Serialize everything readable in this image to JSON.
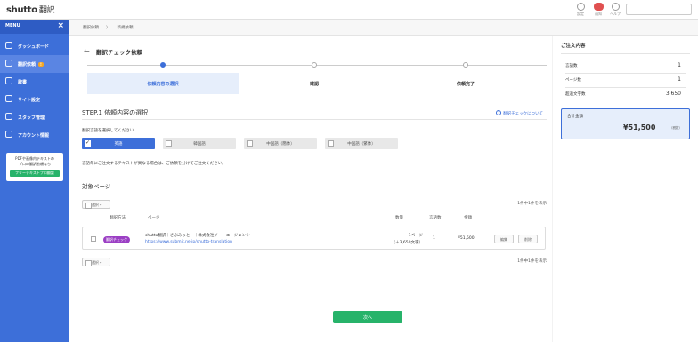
{
  "app": {
    "logo": "shutto",
    "logo_sub": "翻訳"
  },
  "topbar": {
    "icons": [
      {
        "name": "settings-icon",
        "label": "設定"
      },
      {
        "name": "notification-icon",
        "label": "通知"
      },
      {
        "name": "help-icon",
        "label": "ヘルプ"
      }
    ]
  },
  "sidebar": {
    "menu_label": "MENU",
    "close_icon": "×",
    "items": [
      {
        "label": "ダッシュボード",
        "icon": "dashboard-icon"
      },
      {
        "label": "翻訳依頼",
        "icon": "translation-request-icon",
        "badge": "!"
      },
      {
        "label": "辞書",
        "icon": "dictionary-icon"
      },
      {
        "label": "サイト設定",
        "icon": "gear-icon"
      },
      {
        "label": "スタッフ管理",
        "icon": "staff-icon"
      },
      {
        "label": "アカウント情報",
        "icon": "account-icon"
      }
    ],
    "promo": {
      "line1": "PDFや画像内テキストの",
      "line2": "プロの翻訳依頼なら",
      "button": "フリーテキストプロ翻訳"
    }
  },
  "breadcrumb": {
    "items": [
      "翻訳依頼",
      "新規依頼"
    ],
    "separator": "〉"
  },
  "main": {
    "back_icon": "←",
    "title": "翻訳チェック依頼",
    "steps": [
      "依頼内容の選択",
      "確認",
      "依頼完了"
    ],
    "step1_title": "STEP.1 依頼内容の選択",
    "help_link": "翻訳チェックについて",
    "lang_prompt": "翻訳言語を選択してください",
    "languages": [
      {
        "label": "英語",
        "checked": true
      },
      {
        "label": "韓国語",
        "checked": false
      },
      {
        "label": "中国語（簡体）",
        "checked": false
      },
      {
        "label": "中国語（繁体）",
        "checked": false
      }
    ],
    "lang_note": "言語毎にご注文するテキストが異なる場合は、ご依頼を分けてご注文ください。",
    "section_title": "対象ページ",
    "select_label": "選択",
    "count_top": "1件中1件を表示",
    "count_bottom": "1件中1件を表示",
    "columns": {
      "method": "翻訳方法",
      "page": "ページ",
      "quantity": "数量",
      "langs": "言語数",
      "amount": "金額"
    },
    "rows": [
      {
        "method_tag": "翻訳チェック",
        "page_title": "shutto翻訳｜さぶみっと！｜株式会社イー・エージェンシー",
        "page_url": "https://www.submit.ne.jp/shutto-translation",
        "quantity": "1ページ",
        "quantity_sub": "（＋3,650文字）",
        "langs": "1",
        "amount": "¥51,500",
        "edit_label": "編集",
        "delete_label": "削除"
      }
    ],
    "next_label": "次へ"
  },
  "summary": {
    "title": "ご注文内容",
    "rows": [
      {
        "label": "言語数",
        "value": "1"
      },
      {
        "label": "ページ数",
        "value": "1"
      },
      {
        "label": "超過文字数",
        "value": "3,650"
      }
    ],
    "total_label": "合計金額",
    "total_value": "¥51,500",
    "tax_note": "（税抜）"
  }
}
